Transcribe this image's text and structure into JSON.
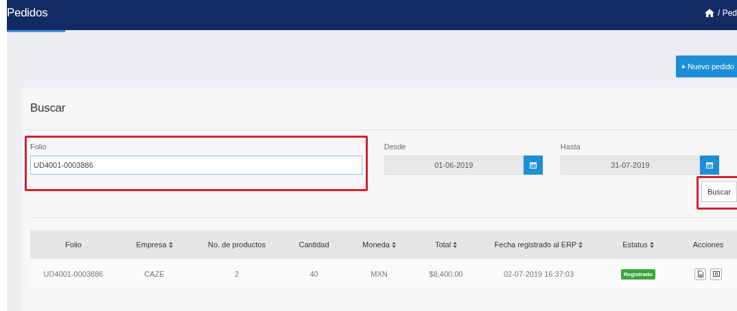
{
  "header": {
    "title": "Pedidos",
    "breadcrumb": "/ Ped"
  },
  "new_button": {
    "icon": "+",
    "label": "Nuevo pedido"
  },
  "search": {
    "title": "Buscar",
    "fields": [
      {
        "kind": "text",
        "label": "Folio",
        "value": "UD4001-0003886",
        "highlighted": true
      },
      {
        "kind": "date",
        "label": "Desde",
        "value": "01-06-2019",
        "highlighted": false
      },
      {
        "kind": "date",
        "label": "Hasta",
        "value": "31-07-2019",
        "highlighted": false
      }
    ],
    "button": {
      "label": "Buscar",
      "highlighted": true
    }
  },
  "table": {
    "columns": [
      {
        "label": "Folio",
        "sortable": false
      },
      {
        "label": "Empresa",
        "sortable": true
      },
      {
        "label": "No. de productos",
        "sortable": false
      },
      {
        "label": "Cantidad",
        "sortable": false
      },
      {
        "label": "Moneda",
        "sortable": true
      },
      {
        "label": "Total",
        "sortable": true
      },
      {
        "label": "Fecha registrado al ERP",
        "sortable": true
      },
      {
        "label": "Estatus",
        "sortable": true
      },
      {
        "label": "Acciones",
        "sortable": false
      }
    ],
    "rows": [
      {
        "cells": [
          "UD4001-0003886",
          "CAZE",
          "2",
          "40",
          "MXN",
          "$8,400.00",
          "02-07-2019 16:37:03"
        ],
        "status": {
          "label": "Registrado",
          "color": "#3aa53a"
        }
      }
    ]
  }
}
